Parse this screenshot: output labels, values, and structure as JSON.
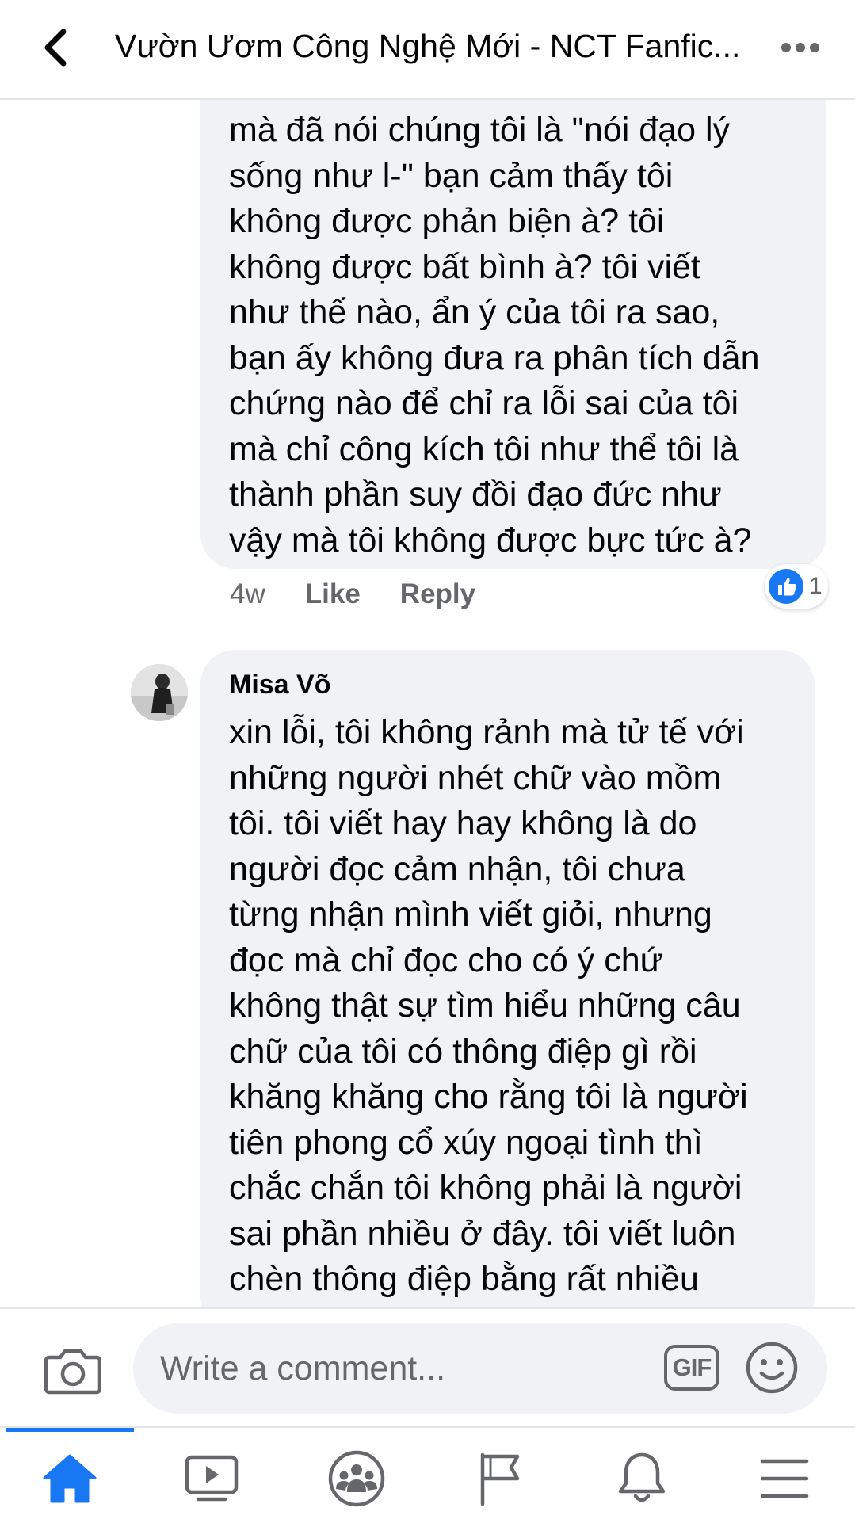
{
  "header": {
    "title": "Vườn Ươm Công Nghệ Mới - NCT Fanfic...",
    "back_icon": "chevron-left-icon",
    "more_icon": "more-horizontal-icon"
  },
  "comment_1": {
    "lines": "mà đã nói chúng tôi là \"nói đạo lý\nsống như l-\" bạn cảm thấy tôi\nkhông được phản biện à? tôi\nkhông được bất bình à? tôi viết\nnhư thế nào, ẩn ý của tôi ra sao,\nbạn ấy không đưa ra phân tích dẫn\nchứng nào để chỉ ra lỗi sai của tôi\nmà chỉ công kích tôi như thể tôi là\nthành phần suy đồi đạo đức như\nvậy mà tôi không được bực tức à?",
    "time": "4w",
    "like_label": "Like",
    "reply_label": "Reply",
    "reaction_icon": "like-reaction-icon",
    "reaction_count": "1"
  },
  "comment_2": {
    "author": "Misa Võ",
    "lines": "xin lỗi, tôi không rảnh mà tử tế với\nnhững người nhét chữ vào mồm\ntôi. tôi viết hay hay không là do\nngười đọc cảm nhận, tôi chưa\ntừng nhận mình viết giỏi, nhưng\nđọc mà chỉ đọc cho có ý chứ\nkhông thật sự tìm hiểu những câu\nchữ của tôi có thông điệp gì rồi\nkhăng khăng cho rằng tôi là người\ntiên phong cổ xúy ngoại tình thì\nchắc chắn tôi không phải là người\nsai phần nhiều ở đây. tôi viết luôn\nchèn thông điệp bằng rất nhiều"
  },
  "composer": {
    "placeholder": "Write a comment...",
    "gif_label": "GIF",
    "camera_icon": "camera-icon",
    "emoji_icon": "emoji-icon"
  },
  "tabbar": {
    "accent": "#1877f2",
    "tabs": [
      "home-icon",
      "video-icon",
      "groups-icon",
      "pages-flag-icon",
      "notifications-bell-icon",
      "menu-icon"
    ]
  }
}
